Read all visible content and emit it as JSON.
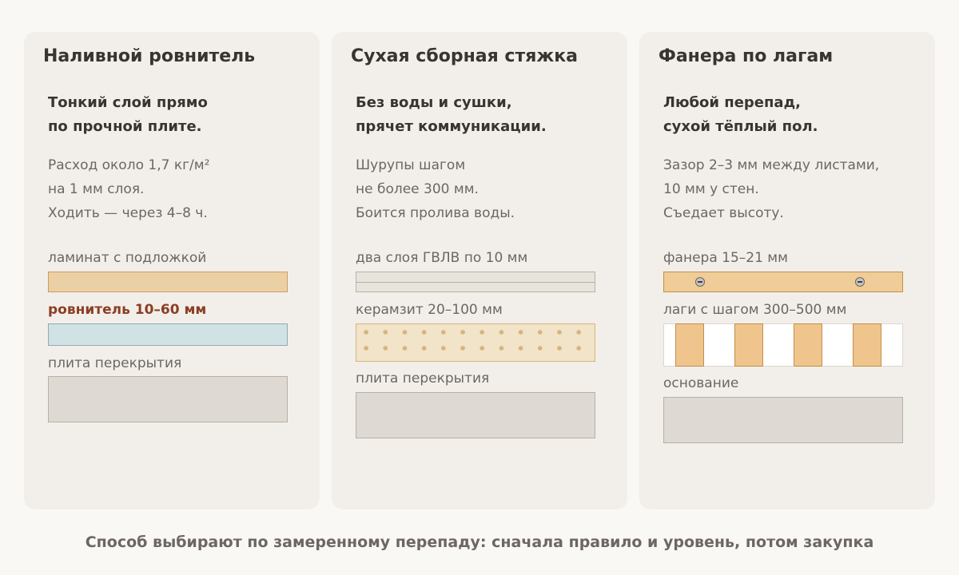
{
  "cards": [
    {
      "title": "Наливной ровнитель",
      "lead": [
        "Тонкий слой прямо",
        "по прочной плите."
      ],
      "notes": [
        "Расход около 1,7 кг/м²",
        "на 1 мм слоя.",
        "Ходить — через 4–8 ч."
      ],
      "layers": [
        {
          "label": "ламинат с подложкой",
          "fill": "laminate"
        },
        {
          "label": "ровнитель 10–60 мм",
          "fill": "leveler",
          "highlighted": true
        },
        {
          "label": "плита перекрытия",
          "fill": "slab"
        }
      ]
    },
    {
      "title": "Сухая сборная стяжка",
      "lead": [
        "Без воды и сушки,",
        "прячет коммуникации."
      ],
      "notes": [
        "Шурупы шагом",
        "не более 300 мм.",
        "Боится пролива воды."
      ],
      "layers": [
        {
          "label": "два слоя ГВЛВ по 10 мм",
          "fill": "gypsum-fiber-double"
        },
        {
          "label": "керамзит 20–100 мм",
          "fill": "expanded-clay"
        },
        {
          "label": "плита перекрытия",
          "fill": "slab"
        }
      ]
    },
    {
      "title": "Фанера по лагам",
      "lead": [
        "Любой перепад,",
        "сухой тёплый пол."
      ],
      "notes": [
        "Зазор 2–3 мм между листами,",
        "10 мм у стен.",
        "Съедает высоту."
      ],
      "layers": [
        {
          "label": "фанера 15–21 мм",
          "fill": "plywood-screwed"
        },
        {
          "label": "лаги с шагом 300–500 мм",
          "fill": "joists",
          "joist_count": 4
        },
        {
          "label": "основание",
          "fill": "base"
        }
      ]
    }
  ],
  "footer": "Способ выбирают по замеренному перепаду: сначала правило и уровень, потом закупка",
  "colors": {
    "background": "#faf8f4",
    "card": "#f2efea",
    "title_text": "#3a3431",
    "muted_text": "#6d6663",
    "accent_label": "#8c3e22",
    "laminate": "#ecd0a5",
    "leveler": "#d1e2e4",
    "slab": "#ded9d2",
    "plywood": "#efcc98",
    "clay_dots": "#d6b47d"
  }
}
